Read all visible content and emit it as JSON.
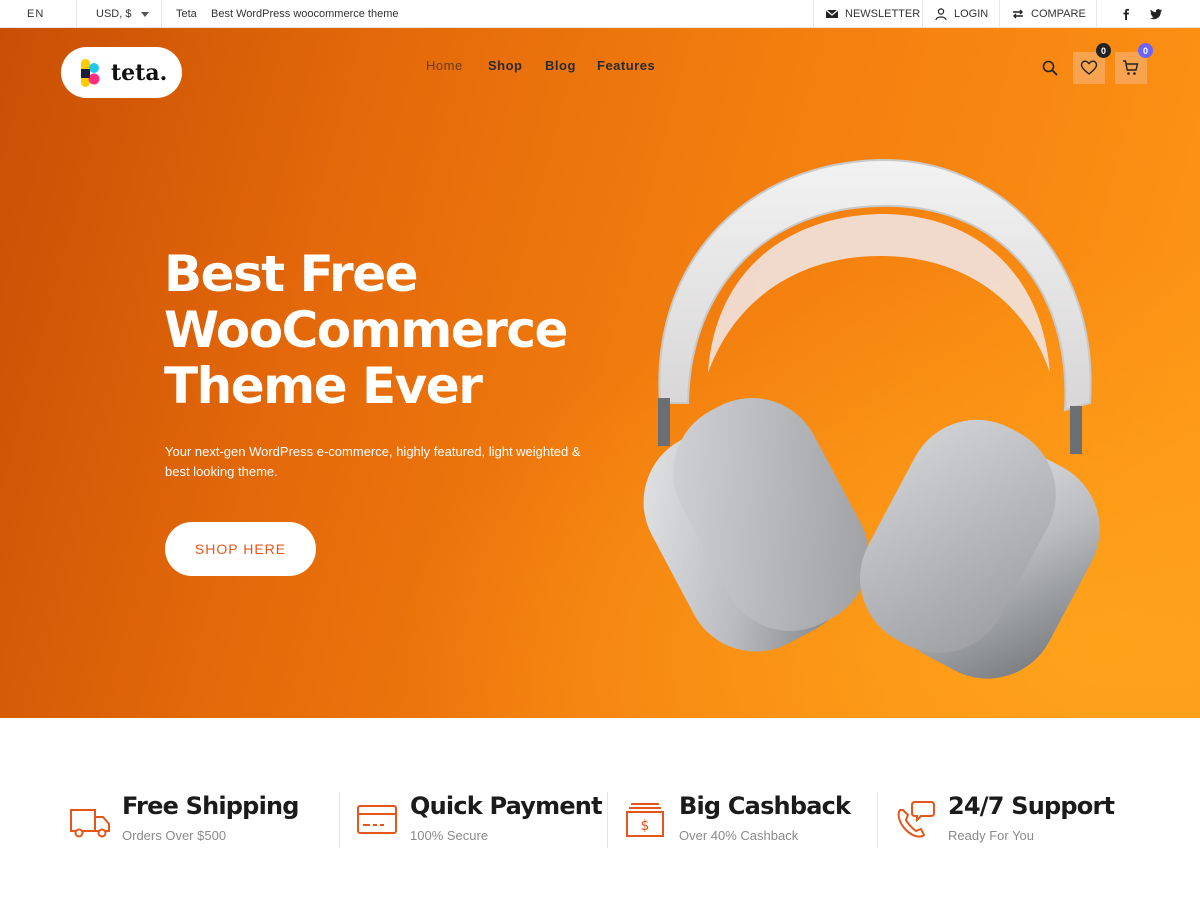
{
  "topbar": {
    "language": "EN",
    "currency": "USD, $",
    "site_name": "Teta",
    "tagline": "Best WordPress woocommerce theme",
    "newsletter_label": "NEWSLETTER",
    "login_label": "LOGIN",
    "compare_label": "COMPARE",
    "social": [
      "facebook-icon",
      "twitter-icon"
    ]
  },
  "header": {
    "logo_text": "teta.",
    "nav": [
      {
        "label": "Home",
        "active": true
      },
      {
        "label": "Shop",
        "active": false
      },
      {
        "label": "Blog",
        "active": false
      },
      {
        "label": "Features",
        "active": false
      }
    ],
    "wishlist_count": "0",
    "cart_count": "0"
  },
  "hero": {
    "headline": [
      "Best Free",
      "WooCommerce",
      "Theme Ever"
    ],
    "subtitle_lines": [
      "Your next-gen WordPress e-commerce, highly featured, light weighted &",
      "best looking theme."
    ],
    "cta_label": "SHOP HERE"
  },
  "features": [
    {
      "icon": "truck-icon",
      "title": "Free Shipping",
      "subtitle": "Orders Over $500"
    },
    {
      "icon": "card-icon",
      "title": "Quick Payment",
      "subtitle": "100% Secure"
    },
    {
      "icon": "cashback-icon",
      "title": "Big Cashback",
      "subtitle": "Over 40% Cashback"
    },
    {
      "icon": "support-icon",
      "title": "24/7 Support",
      "subtitle": "Ready For You"
    }
  ],
  "colors": {
    "accent": "#e5561a",
    "hero_start": "#c84f05",
    "hero_end": "#ff9a18",
    "cart_badge": "#6c63ff",
    "wishlist_badge": "#222222"
  }
}
